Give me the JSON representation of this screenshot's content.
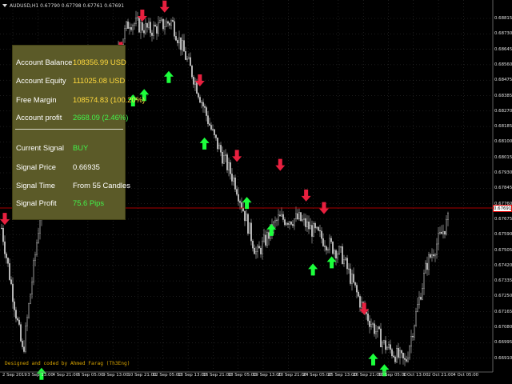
{
  "header": {
    "symbol_info": "AUDUSD,H1  0.67790 0.67798 0.67761 0.67691"
  },
  "panel": {
    "account_balance": {
      "label": "Account Balance",
      "value": "108356.99 USD"
    },
    "account_equity": {
      "label": "Account Equity",
      "value": "111025.08 USD"
    },
    "free_margin": {
      "label": "Free Margin",
      "value": "108574.83 (100.20%)"
    },
    "account_profit": {
      "label": "Account profit",
      "value": "2668.09 (2.46%)"
    },
    "current_signal": {
      "label": "Current Signal",
      "value": "BUY"
    },
    "signal_price": {
      "label": "Signal Price",
      "value": "0.66935"
    },
    "signal_time": {
      "label": "Signal Time",
      "value": "From 55 Candles"
    },
    "signal_profit": {
      "label": "Signal Profit",
      "value": "75.6  Pips"
    }
  },
  "credit": "Designed and coded by Ahmed Farag (Th3Eng)",
  "price_axis": [
    "0.68815",
    "0.68730",
    "0.68645",
    "0.68560",
    "0.68475",
    "0.68385",
    "0.68270",
    "0.68185",
    "0.68100",
    "0.68015",
    "0.67930",
    "0.67845",
    "0.67760",
    "0.67675",
    "0.67590",
    "0.67505",
    "0.67420",
    "0.67335",
    "0.67250",
    "0.67165",
    "0.67080",
    "0.66995",
    "0.66910"
  ],
  "current_price": "0.67691",
  "time_axis": [
    "2 Sep 2019",
    "3 Sep 13:00",
    "4 Sep 21:00",
    "6 Sep 05:00",
    "9 Sep 13:00",
    "10 Sep 21:00",
    "12 Sep 05:00",
    "13 Sep 13:00",
    "16 Sep 21:00",
    "18 Sep 05:00",
    "19 Sep 13:00",
    "20 Sep 21:00",
    "24 Sep 05:00",
    "25 Sep 13:00",
    "26 Sep 21:00",
    "30 Sep 05:00",
    "1 Oct 13:00",
    "2 Oct 21:00",
    "4 Oct 05:00"
  ],
  "colors": {
    "background": "#000000",
    "candle": "#bfbfbf",
    "buy_arrow": "#1cff3c",
    "sell_arrow": "#e8203f",
    "price_line": "#e00000",
    "panel_bg": "#5b5a28"
  },
  "chart_data": {
    "type": "candlestick",
    "x": [
      "2 Sep 2019",
      "3 Sep 13:00",
      "4 Sep 21:00",
      "6 Sep 05:00",
      "9 Sep 13:00",
      "10 Sep 21:00",
      "12 Sep 05:00",
      "13 Sep 13:00",
      "16 Sep 21:00",
      "18 Sep 05:00",
      "19 Sep 13:00",
      "20 Sep 21:00",
      "24 Sep 05:00",
      "25 Sep 13:00",
      "26 Sep 21:00",
      "30 Sep 05:00",
      "1 Oct 13:00",
      "2 Oct 21:00",
      "4 Oct 05:00"
    ],
    "price_path": [
      0.6765,
      0.6695,
      0.679,
      0.684,
      0.686,
      0.685,
      0.688,
      0.6875,
      0.688,
      0.685,
      0.6815,
      0.679,
      0.675,
      0.677,
      0.677,
      0.676,
      0.675,
      0.672,
      0.67,
      0.669,
      0.6745,
      0.6769
    ],
    "ylim": [
      0.6685,
      0.689
    ],
    "last_price": 0.67691,
    "buy_signals": [
      {
        "x": 0.05,
        "y": 0.669
      },
      {
        "x": 0.255,
        "y": 0.6842
      },
      {
        "x": 0.28,
        "y": 0.6845
      },
      {
        "x": 0.335,
        "y": 0.6855
      },
      {
        "x": 0.415,
        "y": 0.6818
      },
      {
        "x": 0.51,
        "y": 0.6785
      },
      {
        "x": 0.565,
        "y": 0.677
      },
      {
        "x": 0.658,
        "y": 0.6748
      },
      {
        "x": 0.7,
        "y": 0.6752
      },
      {
        "x": 0.793,
        "y": 0.6698
      },
      {
        "x": 0.818,
        "y": 0.6692
      }
    ],
    "sell_signals": [
      {
        "x": 0.0,
        "y": 0.6765
      },
      {
        "x": 0.26,
        "y": 0.686
      },
      {
        "x": 0.308,
        "y": 0.6878
      },
      {
        "x": 0.358,
        "y": 0.6883
      },
      {
        "x": 0.437,
        "y": 0.6842
      },
      {
        "x": 0.52,
        "y": 0.68
      },
      {
        "x": 0.617,
        "y": 0.6795
      },
      {
        "x": 0.675,
        "y": 0.6778
      },
      {
        "x": 0.715,
        "y": 0.6771
      },
      {
        "x": 0.805,
        "y": 0.6715
      }
    ]
  }
}
